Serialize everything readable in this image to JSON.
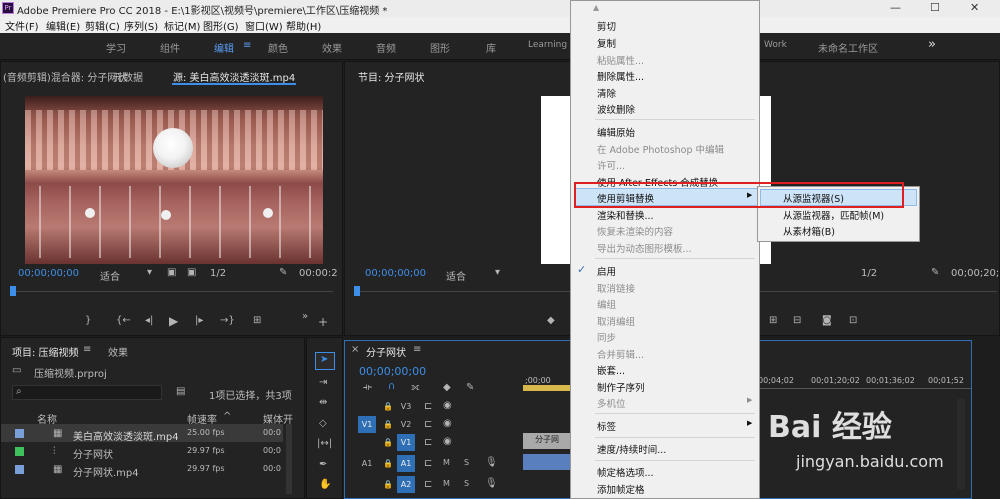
{
  "window": {
    "title": "Adobe Premiere Pro CC 2018 - E:\\1影视区\\视频号\\premiere\\工作区\\压缩视频 *",
    "minimize": "—",
    "maximize": "☐",
    "close": "✕",
    "app_badge": "Pr"
  },
  "menubar": [
    "文件(F)",
    "编辑(E)",
    "剪辑(C)",
    "序列(S)",
    "标记(M)",
    "图形(G)",
    "窗口(W)",
    "帮助(H)"
  ],
  "workspaces": [
    "学习",
    "组件",
    "编辑",
    "颜色",
    "效果",
    "音频",
    "图形",
    "库",
    "Learning",
    "Work",
    "未命名工作区",
    "»"
  ],
  "workspace_active_icon": "≡",
  "source_panel": {
    "tabs": [
      "(音频剪辑)混合器: 分子网状",
      "元数据",
      "源: 美白高效淡透淡斑.mp4"
    ],
    "timecode": "00;00;00;00",
    "fit": "适合",
    "resolution": "1/2",
    "duration": "00:00:2"
  },
  "program_panel": {
    "tab": "节目: 分子网状",
    "timecode": "00;00;00;00",
    "fit": "适合",
    "resolution": "1/2",
    "duration": "00;00;20;"
  },
  "project_panel": {
    "tabs": [
      "项目: 压缩视频",
      "效果"
    ],
    "project_file": "压缩视频.prproj",
    "selection_info": "1项已选择，共3项",
    "columns": [
      "名称",
      "帧速率",
      "媒体开"
    ],
    "rows": [
      {
        "name": "美白高效淡透淡斑.mp4",
        "fps": "25.00 fps",
        "start": "00:0",
        "color": "#7a9ed8"
      },
      {
        "name": "分子网状",
        "fps": "29.97 fps",
        "start": "00;0",
        "color": "#3ec25c"
      },
      {
        "name": "分子网状.mp4",
        "fps": "29.97 fps",
        "start": "00:0",
        "color": "#7a9ed8"
      }
    ]
  },
  "timeline": {
    "tab": "分子网状",
    "timecode": "00;00;00;00",
    "ruler": [
      ";00;00",
      "00;04;02",
      "00;01;20;02",
      "00;01;36;02",
      "00;01;52"
    ],
    "tracks": [
      {
        "label": "V3",
        "target": ""
      },
      {
        "label": "V2",
        "target": "V1"
      },
      {
        "label": "V1",
        "target": ""
      },
      {
        "label": "A1",
        "target": "A1"
      },
      {
        "label": "A2",
        "target": ""
      }
    ],
    "clip_label": "分子网"
  },
  "context_menu": {
    "items": [
      {
        "label": "剪切",
        "enabled": true
      },
      {
        "label": "复制",
        "enabled": true
      },
      {
        "label": "粘贴属性...",
        "enabled": false
      },
      {
        "label": "删除属性...",
        "enabled": true
      },
      {
        "label": "清除",
        "enabled": true
      },
      {
        "label": "波纹删除",
        "enabled": true
      },
      {
        "label": "编辑原始",
        "enabled": true
      },
      {
        "label": "在 Adobe Photoshop 中编辑",
        "enabled": false
      },
      {
        "label": "许可...",
        "enabled": false
      },
      {
        "label": "使用 After Effects 合成替换",
        "enabled": true
      },
      {
        "label": "使用剪辑替换",
        "enabled": true,
        "highlighted": true
      },
      {
        "label": "渲染和替换...",
        "enabled": true
      },
      {
        "label": "恢复未渲染的内容",
        "enabled": false
      },
      {
        "label": "导出为动态图形模板...",
        "enabled": false
      },
      {
        "label": "启用",
        "enabled": true,
        "checked": true
      },
      {
        "label": "取消链接",
        "enabled": false
      },
      {
        "label": "编组",
        "enabled": false
      },
      {
        "label": "取消编组",
        "enabled": false
      },
      {
        "label": "同步",
        "enabled": false
      },
      {
        "label": "合并剪辑...",
        "enabled": false
      },
      {
        "label": "嵌套...",
        "enabled": true
      },
      {
        "label": "制作子序列",
        "enabled": true
      },
      {
        "label": "多机位",
        "enabled": false
      },
      {
        "label": "标签",
        "enabled": true
      },
      {
        "label": "速度/持续时间...",
        "enabled": true
      },
      {
        "label": "帧定格选项...",
        "enabled": true
      },
      {
        "label": "添加帧定格",
        "enabled": true
      }
    ],
    "submenu": [
      "从源监视器(S)",
      "从源监视器，匹配帧(M)",
      "从素材箱(B)"
    ],
    "scroll_up": "▲",
    "submenu_arrow": "▶",
    "check_mark": "✓"
  },
  "watermark": {
    "brand": "Bai 经验",
    "url": "jingyan.baidu.com"
  }
}
